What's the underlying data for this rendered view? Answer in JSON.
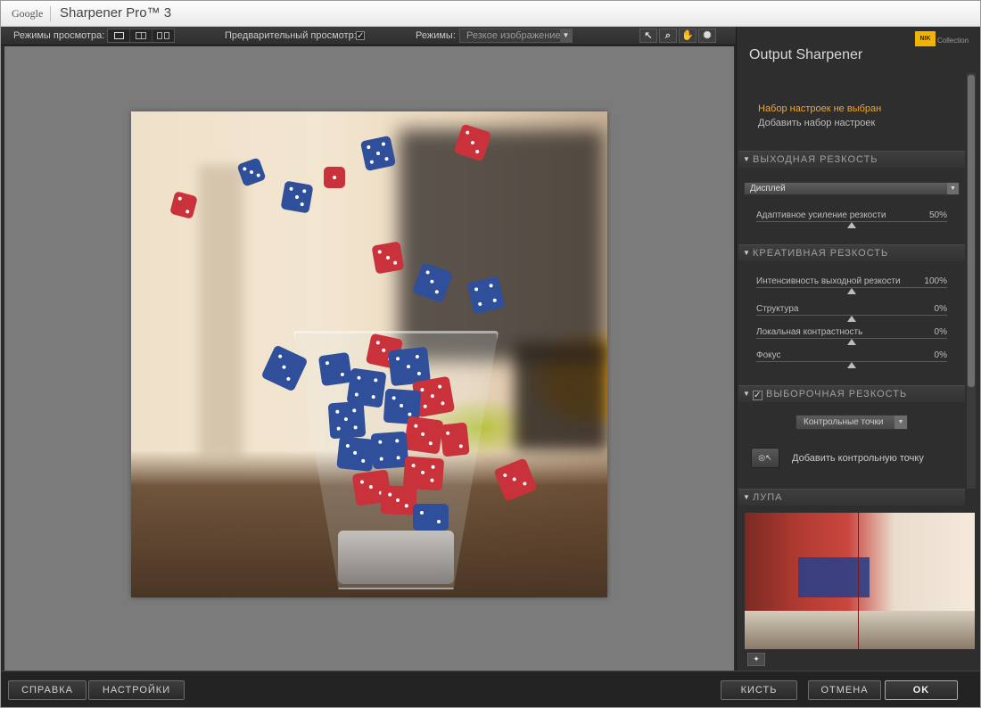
{
  "titlebar": {
    "brand": "Google",
    "app": "Sharpener Pro™ 3"
  },
  "toolbar": {
    "view_modes_label": "Режимы просмотра:",
    "preview_label": "Предварительный просмотр:",
    "preview_checked": true,
    "modes_label": "Режимы:",
    "mode_value": "Резкое изображение",
    "tools": [
      "pointer-icon",
      "zoom-icon",
      "hand-icon",
      "bulb-icon"
    ]
  },
  "panel": {
    "logo": "NIK",
    "logo_sub": "Collection",
    "title": "Output Sharpener",
    "preset_status": "Набор настроек не выбран",
    "preset_add": "Добавить набор настроек",
    "output_section": "ВЫХОДНАЯ РЕЗКОСТЬ",
    "output_device": "Дисплей",
    "adaptive_label": "Адаптивное усиление резкости",
    "adaptive_value": "50%",
    "adaptive_level": 0.5,
    "creative_section": "КРЕАТИВНАЯ РЕЗКОСТЬ",
    "sliders": [
      {
        "label": "Интенсивность выходной резкости",
        "value": "100%",
        "level": 0.5
      },
      {
        "label": "Структура",
        "value": "0%",
        "level": 0.5
      },
      {
        "label": "Локальная контрастность",
        "value": "0%",
        "level": 0.5
      },
      {
        "label": "Фокус",
        "value": "0%",
        "level": 0.5
      }
    ],
    "selective_section": "ВЫБОРОЧНАЯ РЕЗКОСТЬ",
    "selective_checked": true,
    "control_points_value": "Контрольные точки",
    "add_control_point": "Добавить контрольную точку",
    "loupe_section": "ЛУПА"
  },
  "bottom": {
    "help": "СПРАВКА",
    "settings": "НАСТРОЙКИ",
    "brush": "КИСТЬ",
    "cancel": "ОТМЕНА",
    "ok": "OK"
  }
}
